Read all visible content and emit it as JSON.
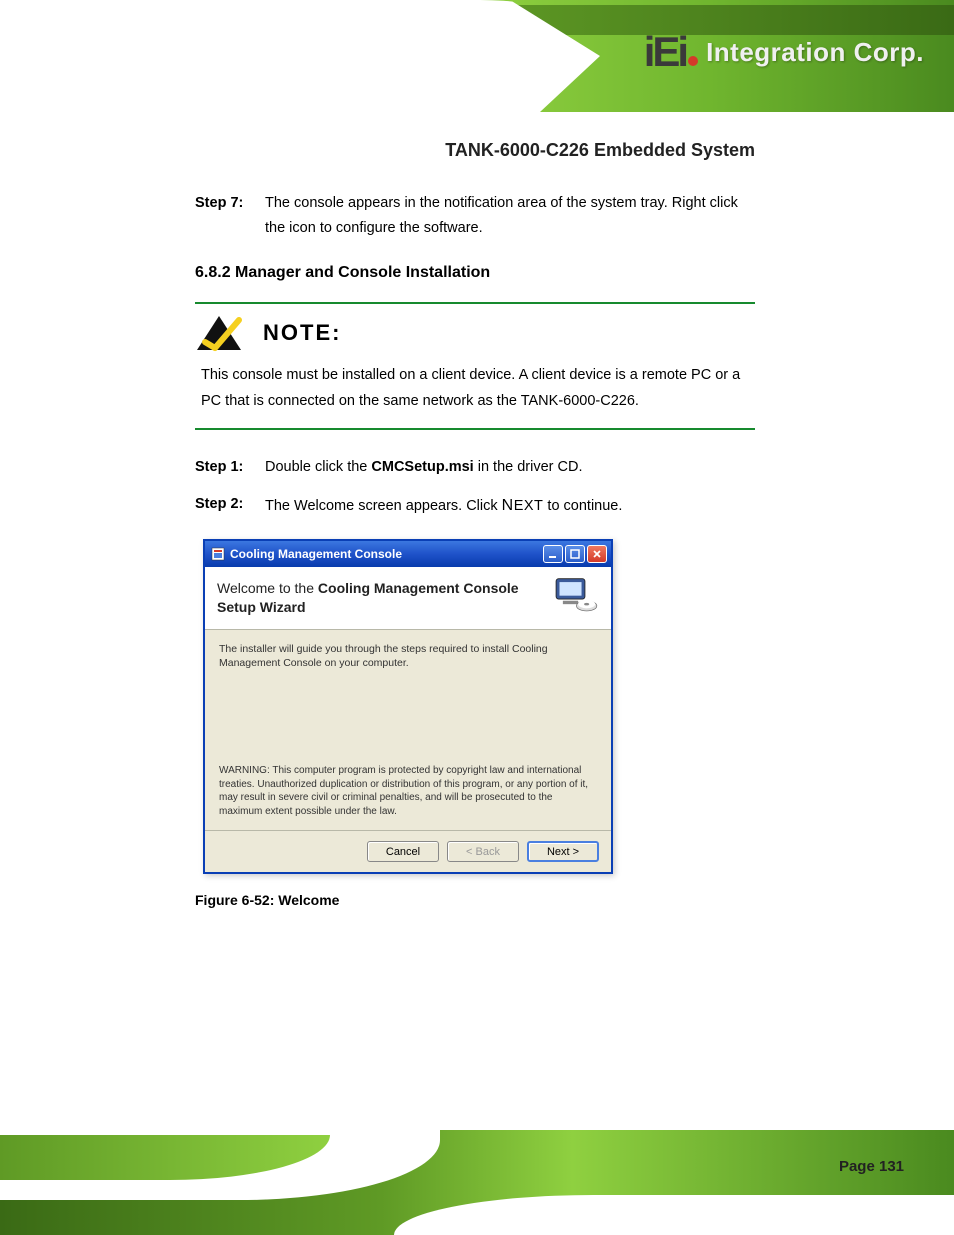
{
  "brand": {
    "logo_main": "iEi",
    "logo_sub": "Integration Corp."
  },
  "doc_title": "TANK-6000-C226 Embedded System",
  "steps_a": [
    {
      "label": "Step 7:",
      "html": "The console appears in the notification area of the system tray. Right click the icon to configure the software."
    }
  ],
  "section_heading": "6.8.2 Manager and Console Installation",
  "note": {
    "label": "NOTE:",
    "text": "This console must be installed on a client device. A client device is a remote PC or a PC that is connected on the same network as the TANK-6000-C226."
  },
  "steps_b": [
    {
      "label": "Step 1:",
      "text_prefix": "Double click the ",
      "bold": "CMCSetup.msi",
      "text_suffix": " in the driver CD."
    },
    {
      "label": "Step 2:",
      "text_prefix": "The Welcome screen appears. Click ",
      "smallcaps1": "N",
      "smallcaps_rest": "EXT",
      "text_suffix": " to continue."
    }
  ],
  "dialog": {
    "title": "Cooling Management Console",
    "welcome_prefix": "Welcome to the ",
    "welcome_bold": "Cooling Management Console Setup Wizard",
    "body_text": "The installer will guide you through the steps required to install Cooling Management Console on your computer.",
    "warning_text": "WARNING: This computer program is protected by copyright law and international treaties. Unauthorized duplication or distribution of this program, or any portion of it, may result in severe civil or criminal penalties, and will be prosecuted to the maximum extent possible under the law.",
    "buttons": {
      "cancel": "Cancel",
      "back": "< Back",
      "next": "Next >"
    }
  },
  "figure_caption": "Figure 6-52: Welcome",
  "page_number": "Page 131"
}
